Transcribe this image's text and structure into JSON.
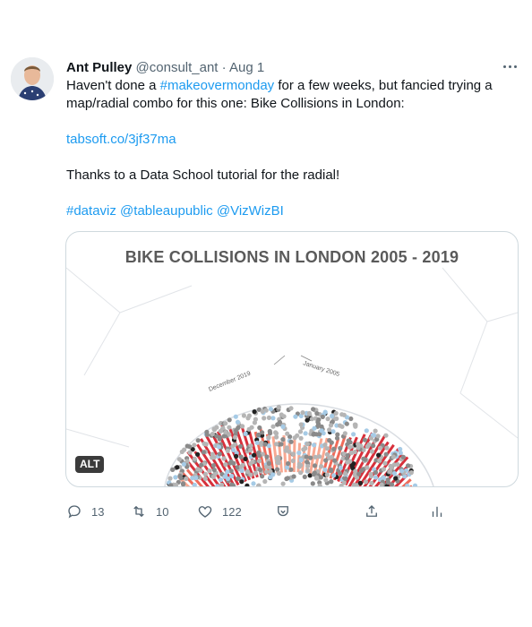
{
  "tweet": {
    "author_name": "Ant Pulley",
    "handle": "@consult_ant",
    "separator": "·",
    "date": "Aug 1",
    "text_line1": "Haven't done a ",
    "hashtag_makeover": "#makeovermonday",
    "text_line1_rest": " for a few weeks, but fancied trying a map/radial combo for this one: Bike Collisions in London:",
    "link": "tabsoft.co/3jf37ma",
    "text_thanks": "Thanks to a Data School tutorial for the radial!",
    "tags": [
      "#dataviz",
      "@tableaupublic",
      "@VizWizBI"
    ]
  },
  "media": {
    "chart_title": "BIKE COLLISIONS IN LONDON 2005 - 2019",
    "label_december": "December 2019",
    "label_january": "January 2005",
    "alt_badge": "ALT"
  },
  "actions": {
    "reply_count": "13",
    "retweet_count": "10",
    "like_count": "122"
  },
  "icons": [
    "more-icon",
    "reply-icon",
    "retweet-icon",
    "like-icon",
    "react-icon",
    "share-icon",
    "analytics-icon"
  ],
  "colors": {
    "link": "#1d9bf0",
    "secondary_text": "#536471",
    "bar_dark": "#d7303b",
    "bar_light": "#f8a892"
  }
}
